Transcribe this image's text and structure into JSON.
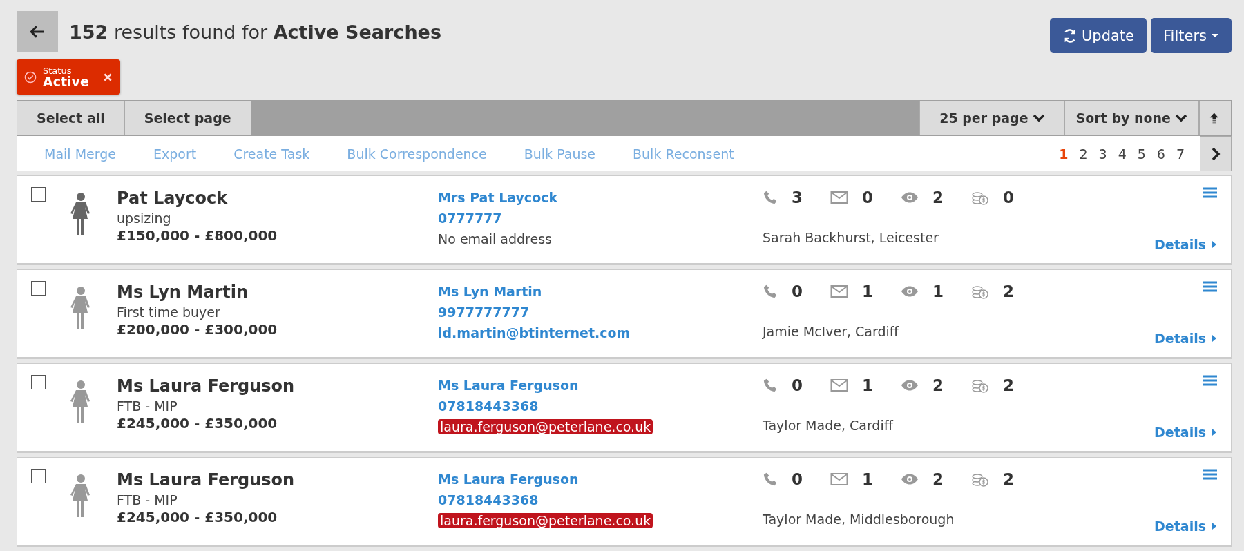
{
  "header": {
    "count": "152",
    "title_middle": "results found for",
    "title_subject": "Active Searches"
  },
  "buttons": {
    "update": "Update",
    "filters": "Filters"
  },
  "filter_chip": {
    "label": "Status",
    "value": "Active"
  },
  "toolbar": {
    "select_all": "Select all",
    "select_page": "Select page",
    "per_page": "25 per page",
    "sort": "Sort by none"
  },
  "actions": [
    "Mail Merge",
    "Export",
    "Create Task",
    "Bulk Correspondence",
    "Bulk Pause",
    "Bulk Reconsent"
  ],
  "pages": [
    {
      "label": "1",
      "selected": true
    },
    {
      "label": "2",
      "selected": false
    },
    {
      "label": "3",
      "selected": false
    },
    {
      "label": "4",
      "selected": false
    },
    {
      "label": "5",
      "selected": false
    },
    {
      "label": "6",
      "selected": false
    },
    {
      "label": "7",
      "selected": false
    }
  ],
  "results": [
    {
      "checked": false,
      "name": "Pat Laycock",
      "type": "upsizing",
      "price": "£150,000 - £800,000",
      "contact_name": "Mrs Pat Laycock",
      "phone": "0777777",
      "email": {
        "text": "No email address",
        "kind": "none"
      },
      "calls": "3",
      "mails": "0",
      "views": "2",
      "offers": "0",
      "agent": "Sarah Backhurst, Leicester",
      "details": "Details"
    },
    {
      "checked": false,
      "name": "Ms Lyn Martin",
      "type": "First time buyer",
      "price": "£200,000 - £300,000",
      "contact_name": "Ms Lyn Martin",
      "phone": "9977777777",
      "email": {
        "text": "ld.martin@btinternet.com",
        "kind": "link"
      },
      "calls": "0",
      "mails": "1",
      "views": "1",
      "offers": "2",
      "agent": "Jamie McIver, Cardiff",
      "details": "Details"
    },
    {
      "checked": false,
      "name": "Ms Laura Ferguson",
      "type": "FTB - MIP",
      "price": "£245,000 - £350,000",
      "contact_name": "Ms Laura Ferguson",
      "phone": "07818443368",
      "email": {
        "text": "laura.ferguson@peterlane.co.uk",
        "kind": "flagged"
      },
      "calls": "0",
      "mails": "1",
      "views": "2",
      "offers": "2",
      "agent": "Taylor Made, Cardiff",
      "details": "Details"
    },
    {
      "checked": false,
      "name": "Ms Laura Ferguson",
      "type": "FTB - MIP",
      "price": "£245,000 - £350,000",
      "contact_name": "Ms Laura Ferguson",
      "phone": "07818443368",
      "email": {
        "text": "laura.ferguson@peterlane.co.uk",
        "kind": "flagged"
      },
      "calls": "0",
      "mails": "1",
      "views": "2",
      "offers": "2",
      "agent": "Taylor Made, Middlesborough",
      "details": "Details"
    }
  ]
}
